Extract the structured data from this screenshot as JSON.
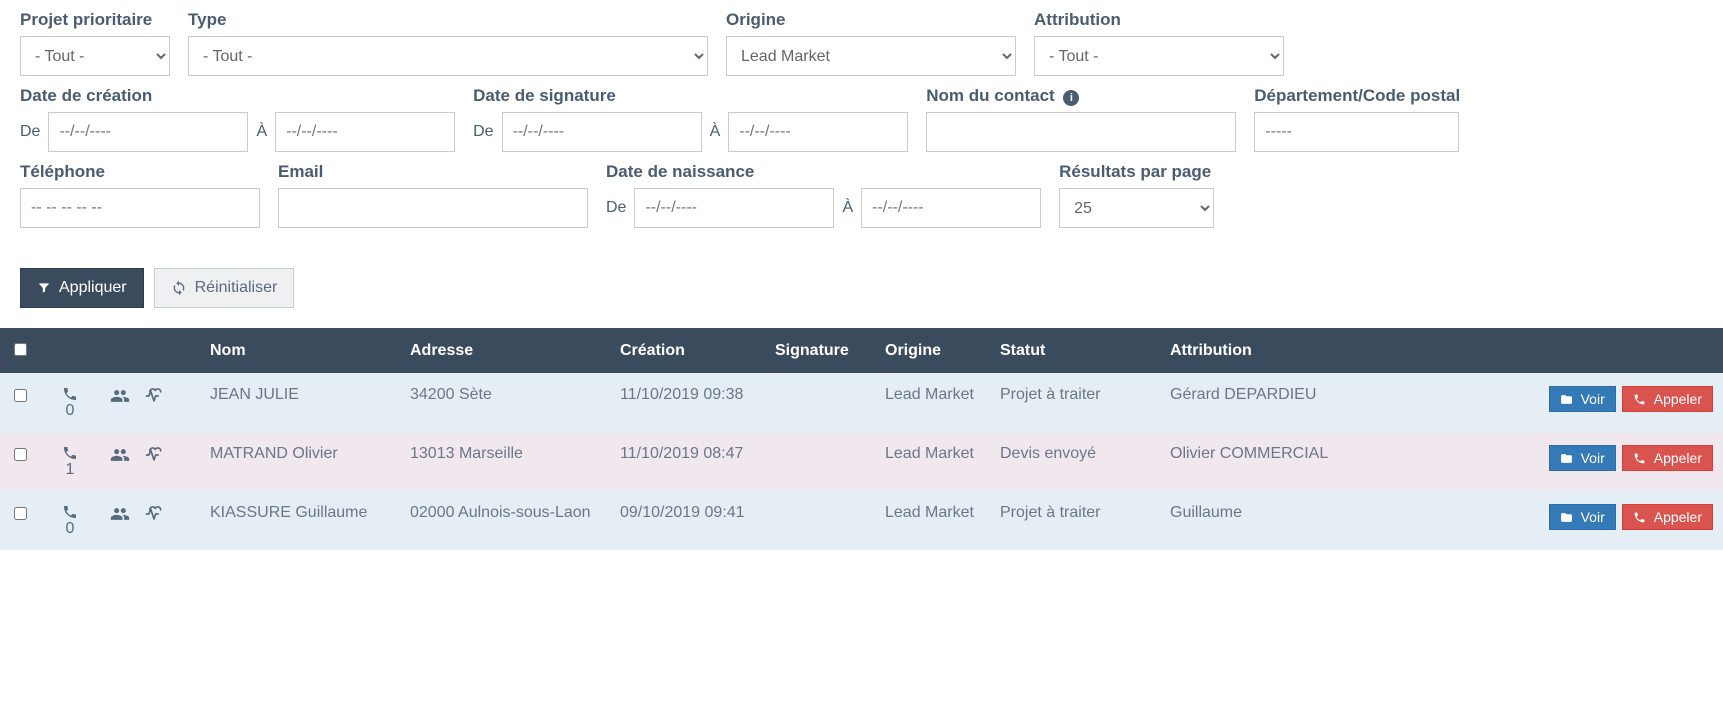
{
  "filters": {
    "projet_prioritaire": {
      "label": "Projet prioritaire",
      "value": "- Tout -"
    },
    "type": {
      "label": "Type",
      "value": "- Tout -"
    },
    "origine": {
      "label": "Origine",
      "value": "Lead Market"
    },
    "attribution": {
      "label": "Attribution",
      "value": "- Tout -"
    },
    "date_creation": {
      "label": "Date de création",
      "from_label": "De",
      "to_label": "À",
      "from_placeholder": "--/--/----",
      "to_placeholder": "--/--/----"
    },
    "date_signature": {
      "label": "Date de signature",
      "from_label": "De",
      "to_label": "À",
      "from_placeholder": "--/--/----",
      "to_placeholder": "--/--/----"
    },
    "nom_contact": {
      "label": "Nom du contact"
    },
    "departement": {
      "label": "Département/Code postal",
      "placeholder": "-----"
    },
    "telephone": {
      "label": "Téléphone",
      "placeholder": "-- -- -- -- --"
    },
    "email": {
      "label": "Email"
    },
    "date_naissance": {
      "label": "Date de naissance",
      "from_label": "De",
      "to_label": "À",
      "from_placeholder": "--/--/----",
      "to_placeholder": "--/--/----"
    },
    "resultats_par_page": {
      "label": "Résultats par page",
      "value": "25"
    }
  },
  "buttons": {
    "appliquer": "Appliquer",
    "reinitialiser": "Réinitialiser",
    "voir": "Voir",
    "appeler": "Appeler"
  },
  "table": {
    "columns": {
      "nom": "Nom",
      "adresse": "Adresse",
      "creation": "Création",
      "signature": "Signature",
      "origine": "Origine",
      "statut": "Statut",
      "attribution": "Attribution"
    },
    "rows": [
      {
        "phone_count": "0",
        "nom": "JEAN JULIE",
        "adresse": "34200 Sète",
        "creation": "11/10/2019 09:38",
        "signature": "",
        "origine": "Lead Market",
        "statut": "Projet à traiter",
        "attribution": "Gérard DEPARDIEU",
        "row_style": "row-blue"
      },
      {
        "phone_count": "1",
        "nom": "MATRAND Olivier",
        "adresse": "13013 Marseille",
        "creation": "11/10/2019 08:47",
        "signature": "",
        "origine": "Lead Market",
        "statut": "Devis envoyé",
        "attribution": "Olivier COMMERCIAL",
        "row_style": "row-pink"
      },
      {
        "phone_count": "0",
        "nom": "KIASSURE Guillaume",
        "adresse": "02000 Aulnois-sous-Laon",
        "creation": "09/10/2019 09:41",
        "signature": "",
        "origine": "Lead Market",
        "statut": "Projet à traiter",
        "attribution": "Guillaume",
        "row_style": "row-blue"
      }
    ]
  }
}
